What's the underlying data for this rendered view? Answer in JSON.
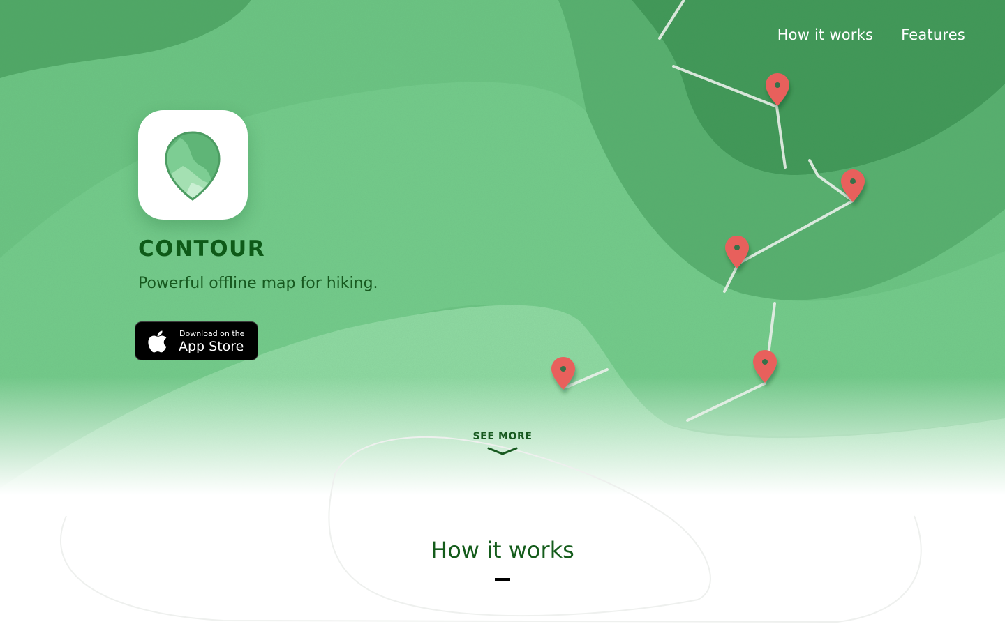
{
  "nav": {
    "items": [
      {
        "label": "How it works"
      },
      {
        "label": "Features"
      }
    ]
  },
  "hero": {
    "brand": "CONTOUR",
    "tagline": "Powerful offline map for hiking.",
    "store_badge": {
      "small_text": "Download on the",
      "big_text": "App Store"
    },
    "see_more": "SEE MORE"
  },
  "section": {
    "title": "How it works"
  },
  "colors": {
    "brand_green": "#0e5a18",
    "pin_red": "#e8605c",
    "hero_green": "#6dc785"
  },
  "icons": [
    "contour-pin-logo-icon",
    "apple-icon",
    "chevron-down-icon",
    "map-pin-icon"
  ]
}
